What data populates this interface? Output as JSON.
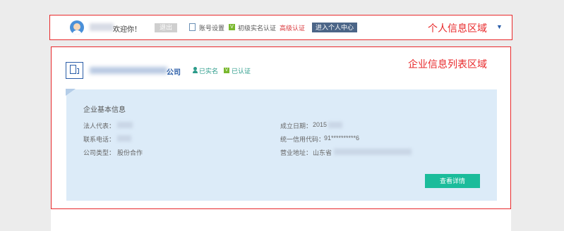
{
  "topbar": {
    "welcome": "欢迎你！",
    "logout": "退出",
    "account_settings": "账号设置",
    "verify_badge": "V",
    "verify_status": "初级实名认证",
    "advanced_verify": "高级认证",
    "personal_center": "进入个人中心",
    "region_label": "个人信息区域",
    "expand_icon": "▼"
  },
  "enterprise": {
    "region_label": "企业信息列表区域",
    "company_suffix": "公司",
    "registered": "已实名",
    "verified_badge": "V",
    "verified": "已认证",
    "card": {
      "title": "企业基本信息",
      "legal_rep_label": "法人代表：",
      "phone_label": "联系电话：",
      "company_type_label": "公司类型：",
      "company_type_value": "股份合作",
      "founded_label": "成立日期：",
      "founded_value": "2015",
      "credit_code_label": "统一信用代码：",
      "credit_code_value": "91**********6",
      "address_label": "营业地址：",
      "address_value": "山东省",
      "detail_button": "查看详情"
    }
  }
}
